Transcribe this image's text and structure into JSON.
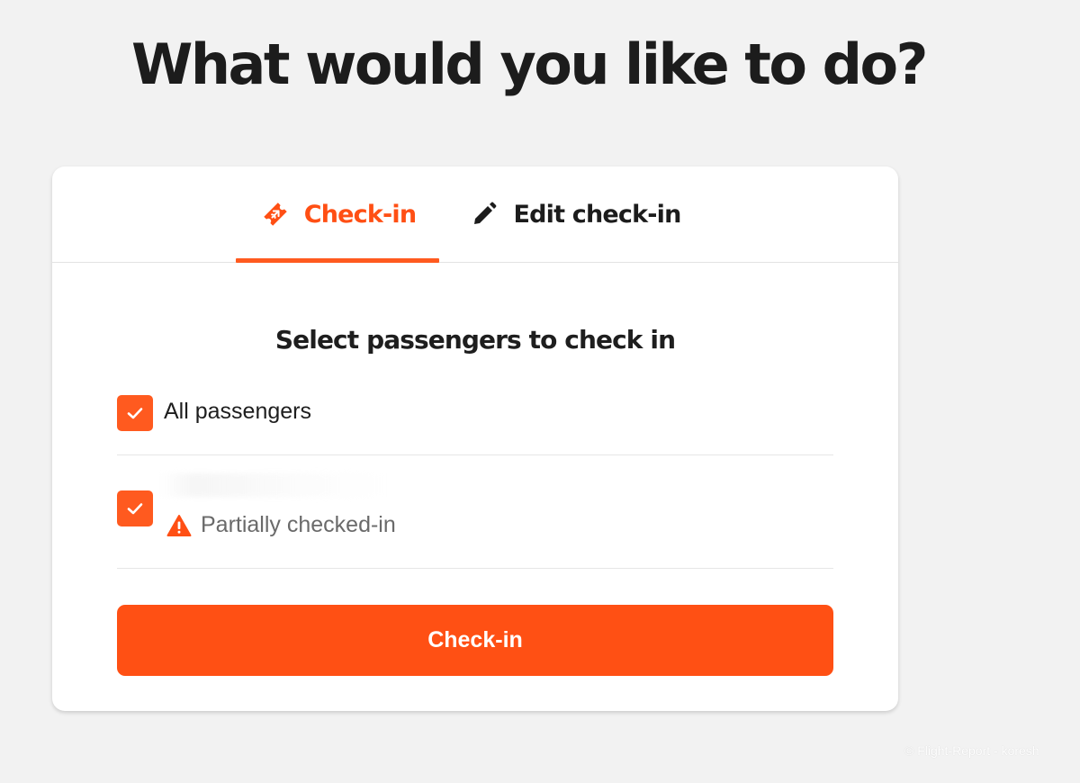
{
  "page": {
    "title": "What would you like to do?"
  },
  "tabs": [
    {
      "label": "Check-in",
      "icon": "ticket-plane-icon",
      "active": true
    },
    {
      "label": "Edit check-in",
      "icon": "pencil-icon",
      "active": false
    }
  ],
  "passenger_section": {
    "heading": "Select passengers to check in",
    "all_passengers_label": "All passengers",
    "all_passengers_checked": true,
    "passenger_checked": true,
    "passenger_status": "Partially checked-in",
    "status_icon": "warning-icon"
  },
  "actions": {
    "submit_label": "Check-in"
  },
  "watermark": "© Flight-Report - koresh",
  "colors": {
    "accent": "#ff5a1f",
    "button": "#ff5014",
    "background": "#f2f2f2",
    "card": "#ffffff",
    "text": "#1e1e1e",
    "muted_text": "#6a6a6a"
  }
}
